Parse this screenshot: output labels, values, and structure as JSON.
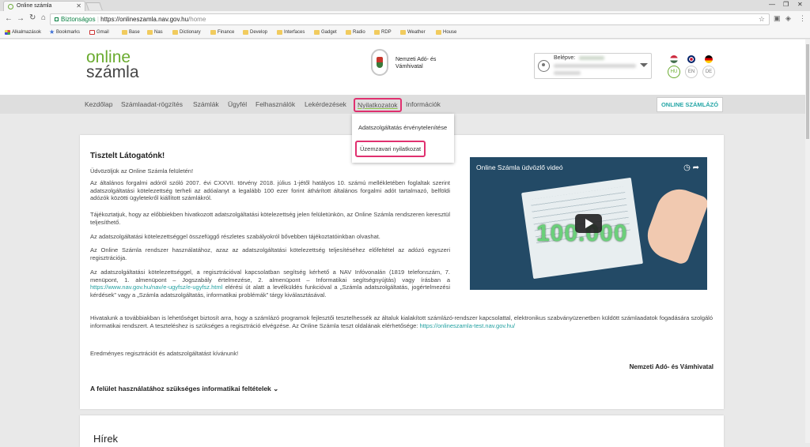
{
  "browser": {
    "tab_title": "Online számla",
    "security_label": "Biztonságos",
    "url_scheme_host": "https://onlineszamla.nav.gov.hu",
    "url_path": "/home"
  },
  "bookmarks": [
    "Alkalmazások",
    "Bookmarks",
    "Gmail",
    "Base",
    "Nas",
    "Dictionary",
    "Finance",
    "Develop",
    "Interfaces",
    "Gadget",
    "Radio",
    "RDP",
    "Weather",
    "House"
  ],
  "header": {
    "logo_line1": "online",
    "logo_line2": "számla",
    "nav_name": "Nemzeti Adó- és Vámhivatal",
    "login_label": "Belépve:",
    "langs": [
      "HU",
      "EN",
      "DE"
    ]
  },
  "menu": {
    "items": [
      "Kezdőlap",
      "Számlaadat-rögzítés",
      "Számlák",
      "Ügyfél",
      "Felhasználók",
      "Lekérdezések",
      "Nyilatkozatok",
      "Információk"
    ],
    "cta": "ONLINE SZÁMLÁZÓ"
  },
  "dropdown": {
    "item1": "Adatszolgáltatás érvénytelenítése",
    "item2": "Üzemzavari nyilatkozat"
  },
  "content": {
    "heading": "Tisztelt Látogatónk!",
    "p1": "Üdvözöljük az Online Számla felületén!",
    "p2": "Az általános forgalmi adóról szóló 2007. évi CXXVII. törvény 2018. július 1-jétől hatályos 10. számú mellékletében foglaltak szerint adatszolgáltatási kötelezettség terheli az adóalanyt a legalább 100 ezer forint áthárított általános forgalmi adót tartalmazó, belföldi adózók közötti ügyletekről kiállított számlákról.",
    "p3": "Tájékoztatjuk, hogy az előbbiekben hivatkozott adatszolgáltatási kötelezettség jelen felületünkön, az Online Számla rendszeren keresztül teljesíthető.",
    "p4": "Az adatszolgáltatási kötelezettséggel összefüggő részletes szabályokról bővebben tájékoztatóinkban olvashat.",
    "p5": "Az Online Számla rendszer használatához, azaz az adatszolgáltatási kötelezettség teljesítéséhez előfeltétel az adózó egyszeri regisztrációja.",
    "p6a": "Az adatszolgáltatási kötelezettséggel, a regisztrációval kapcsolatban segítség kérhető a NAV Infóvonalán (1819 telefonszám, 7. menüpont, 1. almenüpont – Jogszabály értelmezése, 2. almenüpont – Informatikai segítségnyújtás) vagy írásban a ",
    "p6link": "https://www.nav.gov.hu/nav/e-ugyfsz/e-ugyfsz.html",
    "p6b": " elérési út alatt a levélküldés funkcióval a „Számla adatszolgáltatás, jogértelmezési kérdések” vagy a „Számla adatszolgáltatás, informatikai problémák” tárgy kiválasztásával.",
    "p7a": "Hivatalunk a továbbiakban is lehetőséget biztosít arra, hogy a számlázó programok fejlesztői tesztelhessék az általuk kialakított számlázó-rendszer kapcsolattal, elektronikus szabványüzenetben küldött számlaadatok fogadására szolgáló informatikai rendszert. A teszteléshez is szükséges a regisztráció elvégzése. Az Online Számla teszt oldalának elérhetősége: ",
    "p7link": "https://onlineszamla-test.nav.gov.hu/",
    "p8": "Eredményes regisztrációt és adatszolgáltatást kívánunk!",
    "signature": "Nemzeti Adó- és Vámhivatal",
    "toggle": "A felület használatához szükséges informatikai feltételek"
  },
  "video": {
    "title": "Online Számla üdvözlő videó",
    "overlay_number": "100.000"
  },
  "news": {
    "title": "Hírek"
  }
}
